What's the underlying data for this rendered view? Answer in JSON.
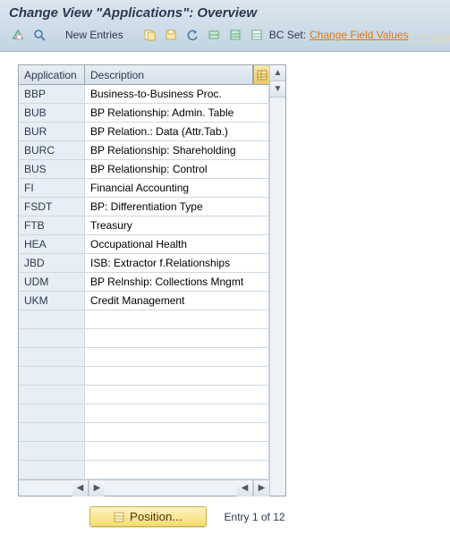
{
  "header": {
    "title": "Change View \"Applications\": Overview",
    "new_entries_label": "New Entries",
    "bcset_label": "BC Set:",
    "bcset_action": "Change Field Values"
  },
  "table": {
    "columns": {
      "app": "Application",
      "desc": "Description"
    },
    "rows": [
      {
        "app": "BBP",
        "desc": "Business-to-Business Proc."
      },
      {
        "app": "BUB",
        "desc": "BP Relationship: Admin. Table"
      },
      {
        "app": "BUR",
        "desc": "BP Relation.: Data (Attr.Tab.)"
      },
      {
        "app": "BURC",
        "desc": "BP Relationship: Shareholding"
      },
      {
        "app": "BUS",
        "desc": "BP Relationship: Control"
      },
      {
        "app": "FI",
        "desc": "Financial Accounting"
      },
      {
        "app": "FSDT",
        "desc": "BP: Differentiation Type"
      },
      {
        "app": "FTB",
        "desc": "Treasury"
      },
      {
        "app": "HEA",
        "desc": "Occupational Health"
      },
      {
        "app": "JBD",
        "desc": "ISB: Extractor f.Relationships"
      },
      {
        "app": "UDM",
        "desc": "BP Relnship: Collections Mngmt"
      },
      {
        "app": "UKM",
        "desc": "Credit Management"
      },
      {
        "app": "",
        "desc": ""
      },
      {
        "app": "",
        "desc": ""
      },
      {
        "app": "",
        "desc": ""
      },
      {
        "app": "",
        "desc": ""
      },
      {
        "app": "",
        "desc": ""
      },
      {
        "app": "",
        "desc": ""
      },
      {
        "app": "",
        "desc": ""
      },
      {
        "app": "",
        "desc": ""
      },
      {
        "app": "",
        "desc": ""
      }
    ]
  },
  "footer": {
    "position_label": "Position...",
    "entry_text": "Entry 1 of 12"
  },
  "watermark": "t.com"
}
